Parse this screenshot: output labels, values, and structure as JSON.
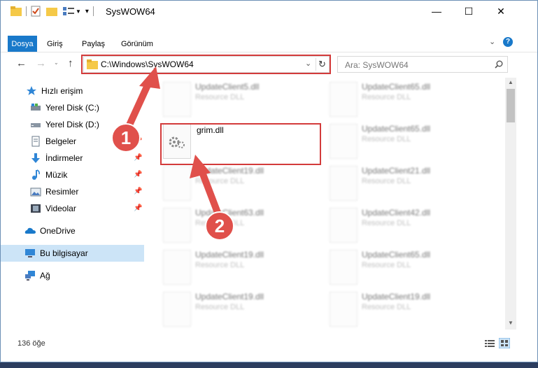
{
  "window": {
    "title": "SysWOW64",
    "controls": {
      "minimize": "—",
      "maximize": "☐",
      "close": "✕"
    }
  },
  "ribbon": {
    "tabs": [
      "Dosya",
      "Giriş",
      "Paylaş",
      "Görünüm"
    ]
  },
  "nav": {
    "address": "C:\\Windows\\SysWOW64",
    "search_placeholder": "Ara: SysWOW64"
  },
  "sidebar": {
    "items": [
      {
        "label": "Hızlı erişim",
        "icon": "star-icon"
      },
      {
        "label": "Yerel Disk (C:)",
        "icon": "drive-c-icon"
      },
      {
        "label": "Yerel Disk (D:)",
        "icon": "drive-d-icon"
      },
      {
        "label": "Belgeler",
        "icon": "documents-icon"
      },
      {
        "label": "İndirmeler",
        "icon": "download-icon"
      },
      {
        "label": "Müzik",
        "icon": "music-icon"
      },
      {
        "label": "Resimler",
        "icon": "pictures-icon"
      },
      {
        "label": "Videolar",
        "icon": "videos-icon"
      },
      {
        "label": "OneDrive",
        "icon": "cloud-icon"
      },
      {
        "label": "Bu bilgisayar",
        "icon": "computer-icon"
      },
      {
        "label": "Ağ",
        "icon": "network-icon"
      }
    ]
  },
  "files": {
    "left": [
      {
        "name": "UpdateClient5.dll",
        "type": "Resource DLL"
      },
      {
        "name": "grim.dll",
        "type": ""
      },
      {
        "name": "UpdateClient19.dll",
        "type": "Resource DLL"
      },
      {
        "name": "UpdateClient63.dll",
        "type": "Resource DLL"
      },
      {
        "name": "UpdateClient19.dll",
        "type": "Resource DLL"
      },
      {
        "name": "UpdateClient19.dll",
        "type": "Resource DLL"
      }
    ],
    "right": [
      {
        "name": "UpdateClient65.dll",
        "type": "Resource DLL"
      },
      {
        "name": "UpdateClient65.dll",
        "type": "Resource DLL"
      },
      {
        "name": "UpdateClient21.dll",
        "type": "Resource DLL"
      },
      {
        "name": "UpdateClient42.dll",
        "type": "Resource DLL"
      },
      {
        "name": "UpdateClient65.dll",
        "type": "Resource DLL"
      },
      {
        "name": "UpdateClient19.dll",
        "type": "Resource DLL"
      }
    ]
  },
  "annotations": {
    "step1": "1",
    "step2": "2"
  },
  "status": {
    "count": "136 öğe"
  },
  "colors": {
    "accent": "#1979ca",
    "highlight": "#d33b3b",
    "arrow": "#e0504b",
    "folder": "#f5c948"
  }
}
